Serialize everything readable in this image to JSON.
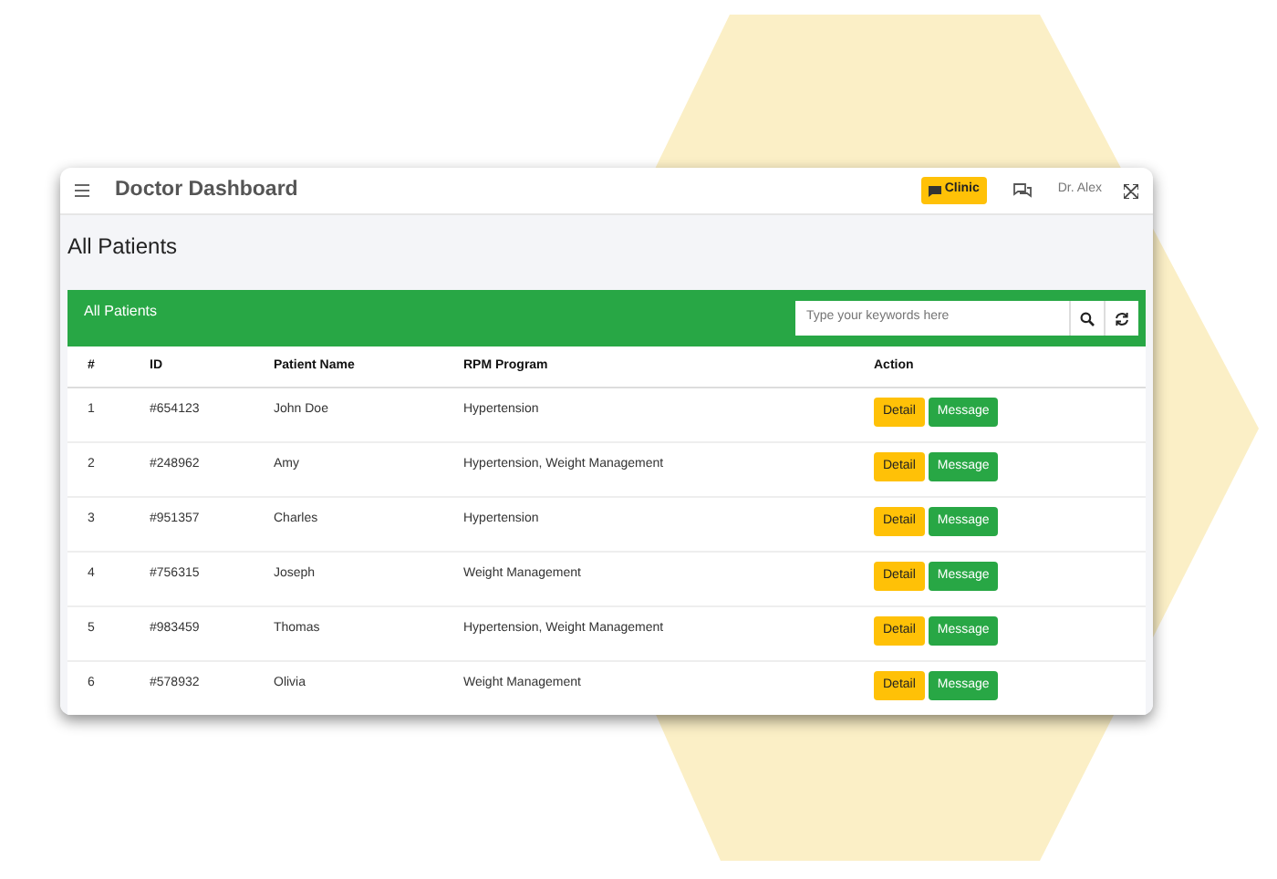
{
  "header": {
    "title": "Doctor Dashboard",
    "badge": "Clinic",
    "user": "Dr. Alex"
  },
  "page_title": "All Patients",
  "card": {
    "title": "All Patients",
    "search": {
      "placeholder": "Type your keywords here"
    }
  },
  "table": {
    "columns": [
      "#",
      "ID",
      "Patient Name",
      "RPM Program",
      "Action"
    ],
    "rows": [
      {
        "num": "1",
        "id": "#654123",
        "name": "John Doe",
        "program": "Hypertension",
        "actions": [
          "Detail",
          "Message"
        ]
      },
      {
        "num": "2",
        "id": "#248962",
        "name": "Amy",
        "program": "Hypertension, Weight Management",
        "actions": [
          "Detail",
          "Message"
        ]
      },
      {
        "num": "3",
        "id": "#951357",
        "name": "Charles",
        "program": "Hypertension",
        "actions": [
          "Detail",
          "Message"
        ]
      },
      {
        "num": "4",
        "id": "#756315",
        "name": "Joseph",
        "program": "Weight Management",
        "actions": [
          "Detail",
          "Message"
        ]
      },
      {
        "num": "5",
        "id": "#983459",
        "name": "Thomas",
        "program": "Hypertension, Weight Management",
        "actions": [
          "Detail",
          "Message"
        ]
      },
      {
        "num": "6",
        "id": "#578932",
        "name": "Olivia",
        "program": "Weight Management",
        "actions": [
          "Detail",
          "Message"
        ]
      }
    ]
  }
}
